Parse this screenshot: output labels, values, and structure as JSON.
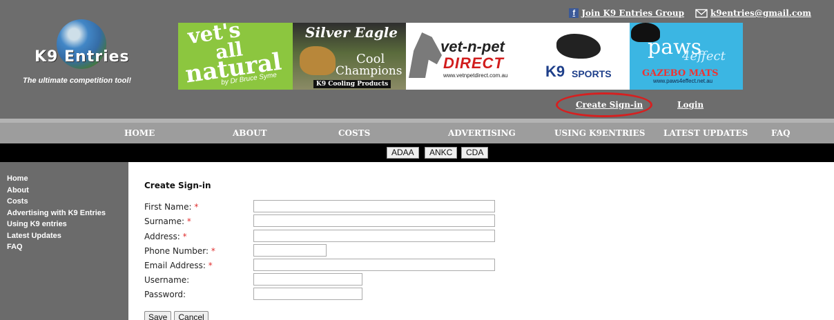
{
  "header": {
    "facebook_link": "Join K9 Entries Group",
    "email_link": "k9entries@gmail.com",
    "logo_text": "K9 Entries",
    "tagline": "The ultimate competition tool!",
    "create_signin": "Create Sign-in",
    "login": "Login"
  },
  "banners": {
    "vets_all_natural": {
      "line1": "vet's",
      "line2": "all",
      "line3": "natural",
      "byline": "by Dr Bruce Syme"
    },
    "silver_eagle": {
      "title": "Silver Eagle",
      "line1": "Cool",
      "line2": "Champions",
      "footer": "K9 Cooling Products"
    },
    "vet_n_pet": {
      "line1": "vet-n-pet",
      "line2": "DIRECT",
      "url": "www.vetnpetdirect.com.au"
    },
    "k9_sports": {
      "line1": "K9",
      "line2": "SPORTS"
    },
    "paws4effect": {
      "line1": "paws",
      "line2": "4effect",
      "line3": "GAZEBO MATS",
      "url": "www.paws4effect.net.au"
    }
  },
  "nav": {
    "items": [
      "HOME",
      "ABOUT",
      "COSTS",
      "ADVERTISING",
      "USING K9ENTRIES",
      "LATEST UPDATES",
      "FAQ"
    ]
  },
  "subnav": {
    "items": [
      "ADAA",
      "ANKC",
      "CDA"
    ]
  },
  "sidebar": {
    "items": [
      "Home",
      "About",
      "Costs",
      "Advertising with K9 Entries",
      "Using K9 entries",
      "Latest Updates",
      "FAQ"
    ]
  },
  "form": {
    "title": "Create Sign-in",
    "fields": [
      {
        "label": "First Name:",
        "required": "*",
        "value": ""
      },
      {
        "label": "Surname:",
        "required": "*",
        "value": ""
      },
      {
        "label": "Address:",
        "required": "*",
        "value": ""
      },
      {
        "label": "Phone Number:",
        "required": "*",
        "value": ""
      },
      {
        "label": "Email Address:",
        "required": "*",
        "value": ""
      },
      {
        "label": "Username:",
        "required": "",
        "value": ""
      },
      {
        "label": "Password:",
        "required": "",
        "value": ""
      }
    ],
    "save": "Save",
    "cancel": "Cancel"
  },
  "colors": {
    "header_bg": "#6d6d6d",
    "nav_bg": "#9d9d9d",
    "subnav_bg": "#000000",
    "highlight_ring": "#d62020",
    "required_star": "#e03030"
  }
}
